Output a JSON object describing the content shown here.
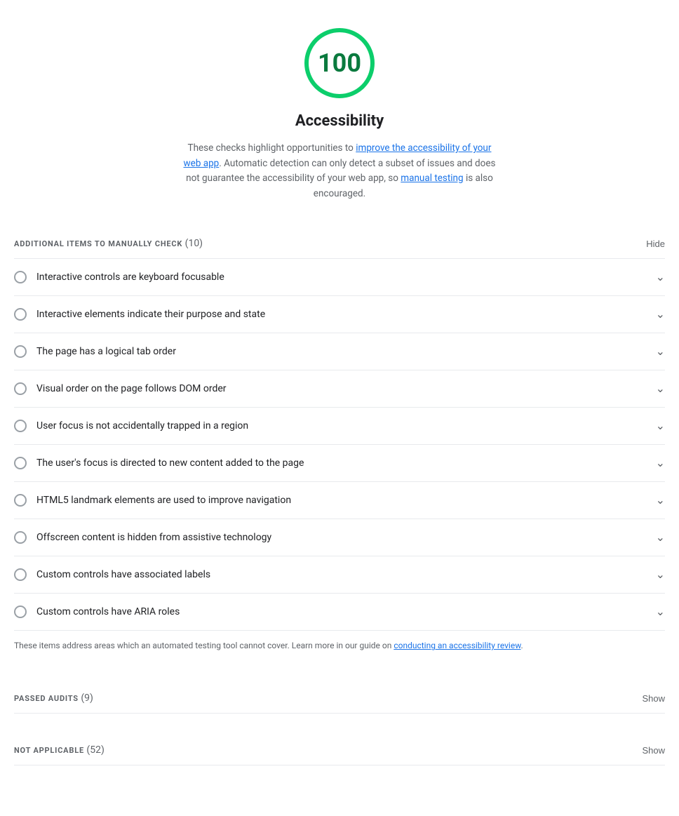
{
  "score": {
    "value": "100",
    "color": "#0cce6b",
    "text_color": "#0a7a3e"
  },
  "title": "Accessibility",
  "description": {
    "prefix": "These checks highlight opportunities to ",
    "link1_text": "improve the accessibility of your web app",
    "link1_href": "#",
    "middle": ". Automatic detection can only detect a subset of issues and does not guarantee the accessibility of your web app, so ",
    "link2_text": "manual testing",
    "link2_href": "#",
    "suffix": " is also encouraged."
  },
  "manual_section": {
    "title": "ADDITIONAL ITEMS TO MANUALLY CHECK",
    "count": "(10)",
    "toggle_label": "Hide"
  },
  "audit_items": [
    {
      "id": "item-1",
      "label": "Interactive controls are keyboard focusable"
    },
    {
      "id": "item-2",
      "label": "Interactive elements indicate their purpose and state"
    },
    {
      "id": "item-3",
      "label": "The page has a logical tab order"
    },
    {
      "id": "item-4",
      "label": "Visual order on the page follows DOM order"
    },
    {
      "id": "item-5",
      "label": "User focus is not accidentally trapped in a region"
    },
    {
      "id": "item-6",
      "label": "The user's focus is directed to new content added to the page"
    },
    {
      "id": "item-7",
      "label": "HTML5 landmark elements are used to improve navigation"
    },
    {
      "id": "item-8",
      "label": "Offscreen content is hidden from assistive technology"
    },
    {
      "id": "item-9",
      "label": "Custom controls have associated labels"
    },
    {
      "id": "item-10",
      "label": "Custom controls have ARIA roles"
    }
  ],
  "footer_note": {
    "prefix": "These items address areas which an automated testing tool cannot cover. Learn more in our guide on ",
    "link_text": "conducting an accessibility review",
    "link_href": "#",
    "suffix": "."
  },
  "passed_section": {
    "title": "PASSED AUDITS",
    "count": "(9)",
    "toggle_label": "Show"
  },
  "not_applicable_section": {
    "title": "NOT APPLICABLE",
    "count": "(52)",
    "toggle_label": "Show"
  },
  "icons": {
    "chevron_down": "∨",
    "circle_empty": ""
  }
}
